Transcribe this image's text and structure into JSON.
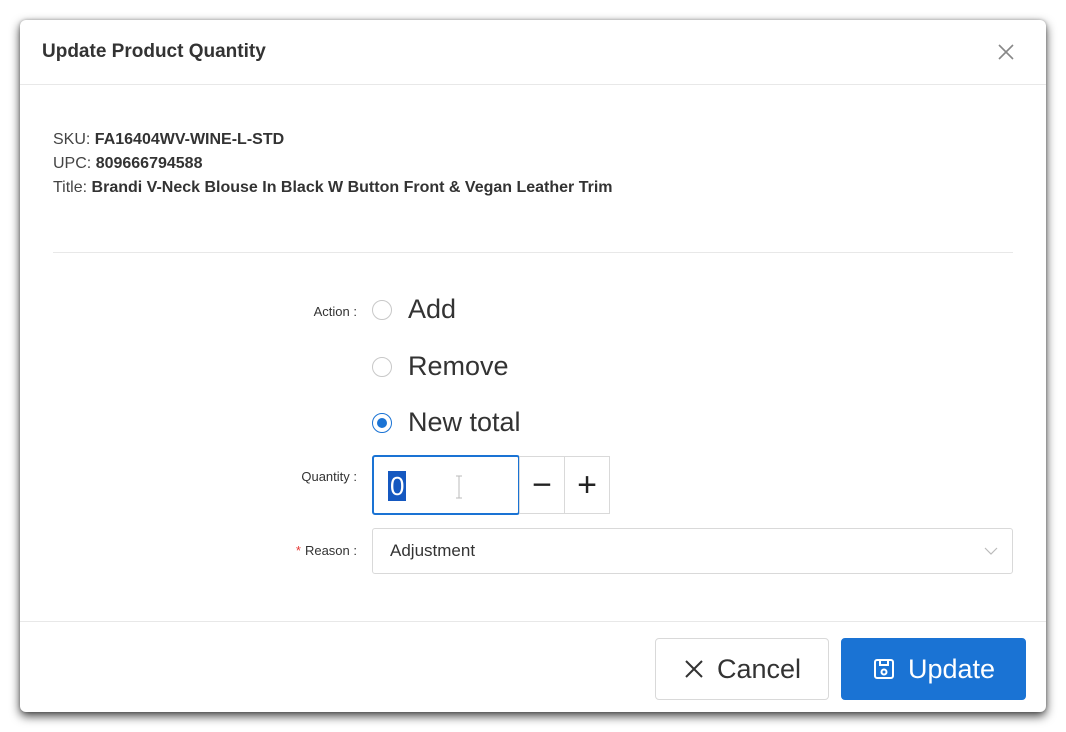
{
  "modal": {
    "title": "Update Product Quantity",
    "close_icon": "close-icon"
  },
  "product": {
    "sku_label": "SKU:",
    "sku": "FA16404WV-WINE-L-STD",
    "upc_label": "UPC:",
    "upc": "809666794588",
    "title_label": "Title:",
    "title": "Brandi V-Neck Blouse In Black W Button Front & Vegan Leather Trim"
  },
  "form": {
    "action_label": "Action :",
    "actions": [
      {
        "label": "Add",
        "selected": false
      },
      {
        "label": "Remove",
        "selected": false
      },
      {
        "label": "New total",
        "selected": true
      }
    ],
    "quantity_label": "Quantity :",
    "quantity_value": "0",
    "decrement_symbol": "−",
    "increment_symbol": "+",
    "reason_required_mark": "*",
    "reason_label": "Reason :",
    "reason_value": "Adjustment",
    "reason_icon": "chevron-down-icon"
  },
  "footer": {
    "cancel_label": "Cancel",
    "cancel_icon": "close-icon",
    "update_label": "Update",
    "update_icon": "save-icon"
  },
  "colors": {
    "accent": "#1a73d4",
    "required": "#e53935"
  }
}
